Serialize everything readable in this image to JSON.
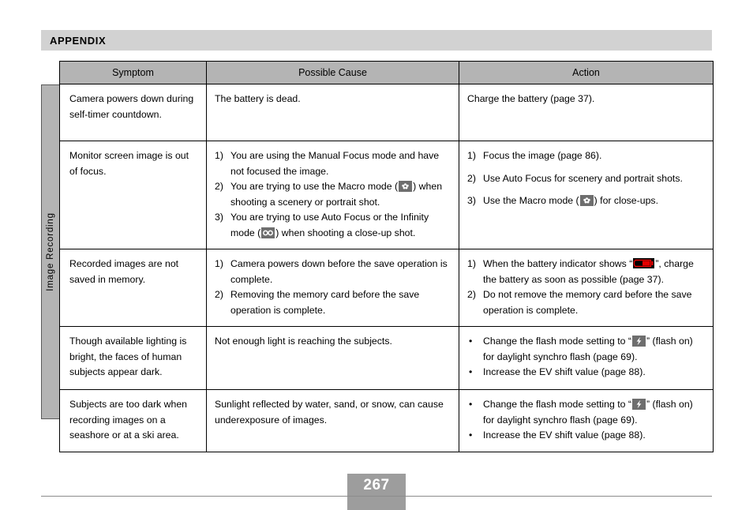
{
  "header": {
    "title": "APPENDIX"
  },
  "side_tab": {
    "label": "Image Recording"
  },
  "table": {
    "columns": [
      "Symptom",
      "Possible Cause",
      "Action"
    ],
    "rows": [
      {
        "symptom": "Camera powers down during self-timer countdown.",
        "cause_plain": "The battery is dead.",
        "action_plain": "Charge the battery (page 37)."
      },
      {
        "symptom": "Monitor screen image is out of focus.",
        "cause_items": [
          {
            "marker": "1)",
            "text_before": "You are using the Manual Focus mode and have not focused the image.",
            "icon": null,
            "text_after": ""
          },
          {
            "marker": "2)",
            "text_before": "You are trying to use the Macro mode (",
            "icon": "macro-icon",
            "text_after": ") when shooting a scenery or portrait shot."
          },
          {
            "marker": "3)",
            "text_before": "You are trying to use Auto Focus or the Infinity mode (",
            "icon": "infinity-icon",
            "text_after": ") when shooting a close-up shot."
          }
        ],
        "action_items": [
          {
            "marker": "1)",
            "text_before": "Focus the image (page 86).",
            "icon": null,
            "text_after": ""
          },
          {
            "marker": "2)",
            "text_before": "Use Auto Focus for scenery and portrait shots.",
            "icon": null,
            "text_after": ""
          },
          {
            "marker": "3)",
            "text_before": "Use the Macro mode (",
            "icon": "macro-icon",
            "text_after": ") for close-ups."
          }
        ]
      },
      {
        "symptom": "Recorded images are not saved in memory.",
        "cause_items": [
          {
            "marker": "1)",
            "text_before": "Camera powers down before the save operation is complete.",
            "icon": null,
            "text_after": ""
          },
          {
            "marker": "2)",
            "text_before": "Removing the memory card before the save operation is complete.",
            "icon": null,
            "text_after": ""
          }
        ],
        "action_items": [
          {
            "marker": "1)",
            "text_before": "When the battery indicator shows “",
            "icon": "battery-empty-icon",
            "text_after": "”, charge the battery as soon as possible (page 37)."
          },
          {
            "marker": "2)",
            "text_before": "Do not remove the memory card before the save operation is complete.",
            "icon": null,
            "text_after": ""
          }
        ]
      },
      {
        "symptom": "Though available lighting is bright, the faces of human subjects appear dark.",
        "cause_plain": "Not enough light is reaching the subjects.",
        "action_items": [
          {
            "marker": "•",
            "text_before": "Change the flash mode setting to “",
            "icon": "flash-on-icon",
            "text_after": "” (flash on) for daylight synchro flash (page 69)."
          },
          {
            "marker": "•",
            "text_before": "Increase the EV shift value (page 88).",
            "icon": null,
            "text_after": ""
          }
        ]
      },
      {
        "symptom": "Subjects are too dark when recording images on a seashore or at a ski area.",
        "cause_plain": "Sunlight reflected by water, sand, or snow, can cause underexposure of images.",
        "action_items": [
          {
            "marker": "•",
            "text_before": "Change the flash mode setting to “",
            "icon": "flash-on-icon",
            "text_after": "” (flash on) for daylight synchro flash (page 69)."
          },
          {
            "marker": "•",
            "text_before": "Increase the EV shift value (page 88).",
            "icon": null,
            "text_after": ""
          }
        ]
      }
    ]
  },
  "footer": {
    "page_number": "267"
  },
  "colors": {
    "band_gray": "#d2d2d2",
    "header_gray": "#b4b4b4",
    "tab_gray": "#b4b4b4",
    "footer_gray": "#9d9d9d",
    "icon_gray": "#6e6e6e",
    "battery_red": "#e60000",
    "rule_gray": "#8c8c8c"
  }
}
